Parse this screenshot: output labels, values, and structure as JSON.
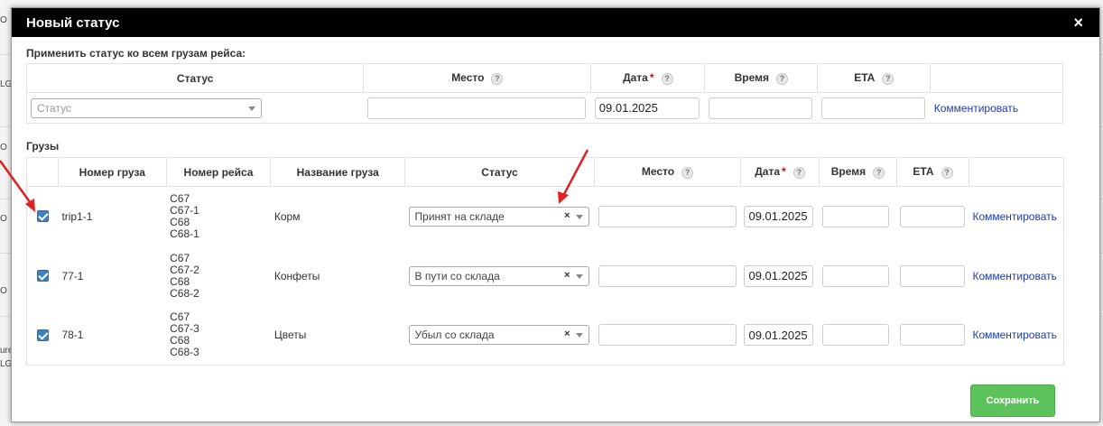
{
  "modal": {
    "title": "Новый статус",
    "close_glyph": "×"
  },
  "apply_all": {
    "label": "Применить статус ко всем грузам рейса:",
    "headers": {
      "status": "Статус",
      "place": "Место",
      "date": "Дата",
      "time": "Время",
      "eta": "ETA"
    },
    "required_mark": "*",
    "help_glyph": "?",
    "status_placeholder": "Статус",
    "place_value": "",
    "date_value": "09.01.2025",
    "time_value": "",
    "eta_value": "",
    "comment_link": "Комментировать"
  },
  "cargo": {
    "label": "Грузы",
    "headers": {
      "cargo_number": "Номер груза",
      "trip_number": "Номер рейса",
      "cargo_name": "Название груза",
      "status": "Статус",
      "place": "Место",
      "date": "Дата",
      "time": "Время",
      "eta": "ETA"
    },
    "rows": [
      {
        "checked": true,
        "cargo_number": "trip1-1",
        "trips": [
          "C67",
          "C67-1",
          "C68",
          "C68-1"
        ],
        "cargo_name": "Корм",
        "status": "Принят на складе",
        "place": "",
        "date": "09.01.2025",
        "time": "",
        "eta": "",
        "comment_link": "Комментировать"
      },
      {
        "checked": true,
        "cargo_number": "77-1",
        "trips": [
          "C67",
          "C67-2",
          "C68",
          "C68-2"
        ],
        "cargo_name": "Конфеты",
        "status": "В пути со склада",
        "place": "",
        "date": "09.01.2025",
        "time": "",
        "eta": "",
        "comment_link": "Комментировать"
      },
      {
        "checked": true,
        "cargo_number": "78-1",
        "trips": [
          "C67",
          "C67-3",
          "C68",
          "C68-3"
        ],
        "cargo_name": "Цветы",
        "status": "Убыл со склада",
        "place": "",
        "date": "09.01.2025",
        "time": "",
        "eta": "",
        "comment_link": "Комментировать"
      }
    ]
  },
  "save_button": "Сохранить",
  "background_fragments": [
    "O",
    "LG",
    "O",
    "O",
    "O",
    "O",
    "ure",
    "LG",
    "O",
    "ure"
  ],
  "colors": {
    "header_bg": "#000000",
    "link": "#1a3bbf",
    "save_button": "#5cc35c",
    "arrow": "#e02020",
    "checkbox": "#3b82c4"
  }
}
